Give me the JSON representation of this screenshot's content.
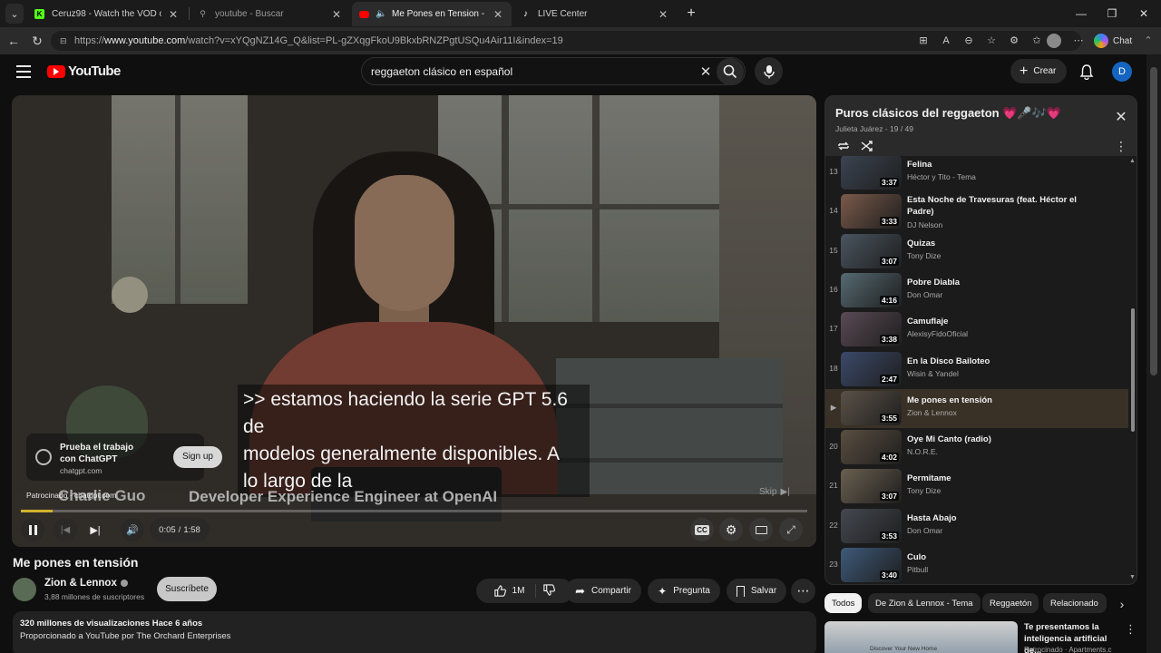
{
  "browser": {
    "tabs": [
      {
        "title": "Ceruz98 - Watch the VOD on Kick",
        "active": false
      },
      {
        "title": "youtube - Buscar",
        "active": false
      },
      {
        "title": "Me Pones en Tension - YouTu",
        "active": true
      },
      {
        "title": "LIVE Center",
        "active": false
      }
    ],
    "url_prefix": "https://",
    "url_host": "www.youtube.com",
    "url_path": "/watch?v=xYQgNZ14G_Q&list=PL-gZXqgFkoU9BkxbRNZPgtUSQu4Air11I&index=19",
    "chat_label": "Chat"
  },
  "header": {
    "logo_text": "YouTube",
    "search_value": "reggaeton clásico en español",
    "create_label": "Crear",
    "avatar_letter": "D"
  },
  "player": {
    "caption_lines": [
      ">> estamos haciendo la serie GPT 5.6",
      "de",
      "modelos generalmente disponibles. A",
      "lo largo de la"
    ],
    "sponsor_title": "Prueba el trabajo con ChatGPT",
    "sponsor_domain": "chatgpt.com",
    "sponsor_button": "Sign up",
    "sponsored_text": "Patrocinado · chatgpt.com",
    "lower_third_name": "Charlie Guo",
    "lower_third_role": "Developer Experience Engineer at OpenAI",
    "skip_label": "Skip",
    "time_current": "0:05",
    "time_total": "1:58",
    "progress_fraction": 0.04
  },
  "video": {
    "title": "Me pones en tensión",
    "channel": "Zion & Lennox",
    "subscribers": "3,88 millones de suscriptores",
    "subscribe_label": "Suscríbete",
    "likes": "1M",
    "share_label": "Compartir",
    "ask_label": "Pregunta",
    "save_label": "Salvar",
    "views_line": "320 millones de visualizaciones  Hace 6 años",
    "provided_line": "Proporcionado a YouTube por The Orchard Enterprises"
  },
  "playlist": {
    "title": "Puros clásicos del reggaeton 💗🎤🎶💗",
    "subtitle": "Julieta Juárez - 19 / 49",
    "items": [
      {
        "index": "13",
        "title": "Felina",
        "artist": "Héctor y Tito - Tema",
        "duration": "3:37"
      },
      {
        "index": "14",
        "title": "Esta Noche de Travesuras (feat. Héctor el Padre)",
        "artist": "DJ Nelson",
        "duration": "3:33"
      },
      {
        "index": "15",
        "title": "Quizas",
        "artist": "Tony Dize",
        "duration": "3:07"
      },
      {
        "index": "16",
        "title": "Pobre Diabla",
        "artist": "Don Omar",
        "duration": "4:16"
      },
      {
        "index": "17",
        "title": "Camuflaje",
        "artist": "AlexisyFidoOficial",
        "duration": "3:38"
      },
      {
        "index": "18",
        "title": "En la Disco Bailoteo",
        "artist": "Wisin & Yandel",
        "duration": "2:47"
      },
      {
        "index": "▶",
        "title": "Me pones en tensión",
        "artist": "Zion & Lennox",
        "duration": "3:55",
        "current": true
      },
      {
        "index": "20",
        "title": "Oye Mi Canto (radio)",
        "artist": "N.O.R.E.",
        "duration": "4:02"
      },
      {
        "index": "21",
        "title": "Permitame",
        "artist": "Tony Dize",
        "duration": "3:07"
      },
      {
        "index": "22",
        "title": "Hasta Abajo",
        "artist": "Don Omar",
        "duration": "3:53"
      },
      {
        "index": "23",
        "title": "Culo",
        "artist": "Pitbull",
        "duration": "3:40"
      }
    ]
  },
  "chips": [
    "Todos",
    "De Zion & Lennox - Tema",
    "Reggaetón",
    "Relacionado"
  ],
  "ad": {
    "title": "Te presentamos la inteligencia artificial de...",
    "subtitle": "Patrocinado · Apartments.c",
    "thumb_text": "Discover Your New Home"
  },
  "colors": {
    "accent_red": "#ff0000",
    "progress_yellow": "#d1b32b",
    "current_item_bg": "#3a3126"
  }
}
